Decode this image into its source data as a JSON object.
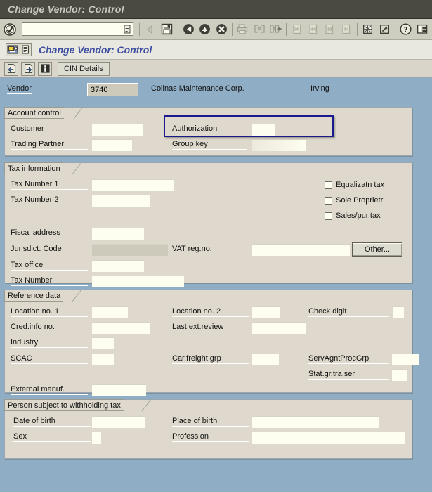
{
  "window": {
    "title": "Change Vendor: Control"
  },
  "toolbar": {
    "command_value": "",
    "command_placeholder": "",
    "icons": [
      "enter-check-icon",
      "save-icon",
      "back-icon",
      "exit-icon",
      "cancel-icon",
      "print-icon",
      "find-icon",
      "find-next-icon",
      "first-page-icon",
      "previous-page-icon",
      "next-page-icon",
      "last-page-icon",
      "new-session-icon",
      "create-shortcut-icon",
      "help-icon",
      "customize-layout-icon"
    ]
  },
  "program_title": {
    "text": "Change Vendor: Control"
  },
  "app_toolbar": {
    "buttons": [
      "previous-screen-icon",
      "next-screen-icon",
      "info-icon"
    ],
    "cin_details_label": "CIN Details"
  },
  "header": {
    "vendor_label": "Vendor",
    "vendor_value": "3740",
    "vendor_name": "Colinas Maintenance Corp.",
    "vendor_city": "Irving"
  },
  "account_control": {
    "caption": "Account control",
    "customer_label": "Customer",
    "customer_value": "",
    "trading_partner_label": "Trading Partner",
    "trading_partner_value": "",
    "authorization_label": "Authorization",
    "authorization_value": "",
    "group_key_label": "Group key",
    "group_key_value": "",
    "highlight_color": "#1a1a8c"
  },
  "tax_information": {
    "caption": "Tax information",
    "tax_number_1_label": "Tax Number 1",
    "tax_number_1_value": "",
    "tax_number_2_label": "Tax Number 2",
    "tax_number_2_value": "",
    "fiscal_address_label": "Fiscal address",
    "fiscal_address_value": "",
    "jurisdiction_code_label": "Jurisdict. Code",
    "jurisdiction_code_value": "",
    "vat_reg_no_label": "VAT reg.no.",
    "vat_reg_no_value": "",
    "other_button_label": "Other...",
    "tax_office_label": "Tax office",
    "tax_office_value": "",
    "tax_number_label": "Tax Number",
    "tax_number_value": "",
    "checkboxes": [
      {
        "label": "Equalizatn tax",
        "checked": false
      },
      {
        "label": "Sole Proprietr",
        "checked": false
      },
      {
        "label": "Sales/pur.tax",
        "checked": false
      }
    ]
  },
  "reference_data": {
    "caption": "Reference data",
    "location_no_1_label": "Location no. 1",
    "location_no_1_value": "",
    "location_no_2_label": "Location no. 2",
    "location_no_2_value": "",
    "check_digit_label": "Check digit",
    "check_digit_value": "",
    "cred_info_no_label": "Cred.info no.",
    "cred_info_no_value": "",
    "last_ext_review_label": "Last ext.review",
    "last_ext_review_value": "",
    "industry_label": "Industry",
    "industry_value": "",
    "scac_label": "SCAC",
    "scac_value": "",
    "car_freight_grp_label": "Car.freight grp",
    "car_freight_grp_value": "",
    "serv_agnt_proc_grp_label": "ServAgntProcGrp",
    "serv_agnt_proc_grp_value": "",
    "stat_gr_tra_ser_label": "Stat.gr.tra.ser",
    "stat_gr_tra_ser_value": "",
    "external_manuf_label": "External manuf.",
    "external_manuf_value": ""
  },
  "withholding_tax": {
    "caption": "Person subject to withholding tax",
    "date_of_birth_label": "Date of birth",
    "date_of_birth_value": "",
    "place_of_birth_label": "Place of birth",
    "place_of_birth_value": "",
    "sex_label": "Sex",
    "sex_value": "",
    "profession_label": "Profession",
    "profession_value": ""
  },
  "theme": {
    "desktop_bg": "#8fadc4",
    "panel_bg": "#ded9cc",
    "field_bg": "#fdfdf0",
    "title_bar_bg": "#4a4a42",
    "program_title_color": "#3f4fa0"
  }
}
